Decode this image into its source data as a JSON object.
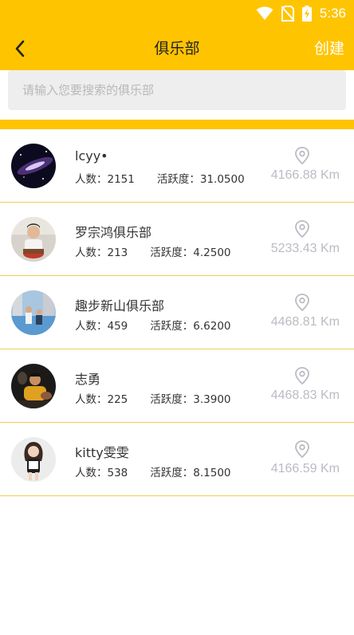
{
  "status_bar": {
    "time": "5:36",
    "icons": [
      "wifi-icon",
      "no-sim-icon",
      "battery-charging-icon"
    ]
  },
  "app_bar": {
    "back_icon": "chevron-left-icon",
    "title": "俱乐部",
    "create_label": "创建"
  },
  "search": {
    "placeholder": "请输入您要搜索的俱乐部",
    "value": ""
  },
  "labels": {
    "members": "人数：",
    "activity": "活跃度："
  },
  "clubs": [
    {
      "name": "lcyy•",
      "members": "2151",
      "activity": "31.0500",
      "distance": "4166.88 Km"
    },
    {
      "name": "罗宗鸿俱乐部",
      "members": "213",
      "activity": "4.2500",
      "distance": "5233.43 Km"
    },
    {
      "name": "趣步新山俱乐部",
      "members": "459",
      "activity": "6.6200",
      "distance": "4468.81 Km"
    },
    {
      "name": "志勇",
      "members": "225",
      "activity": "3.3900",
      "distance": "4468.83 Km"
    },
    {
      "name": "kitty雯雯",
      "members": "538",
      "activity": "8.1500",
      "distance": "4166.59 Km"
    }
  ],
  "colors": {
    "accent": "#ffc400",
    "divider": "#f0cc55",
    "distance_text": "#b9bcc2"
  }
}
